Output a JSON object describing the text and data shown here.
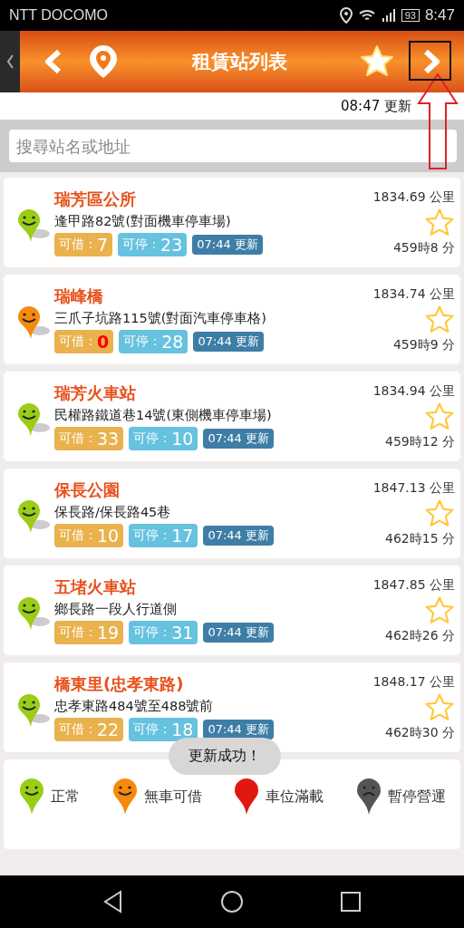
{
  "status_bar": {
    "carrier": "NTT DOCOMO",
    "battery": "93",
    "time": "8:47"
  },
  "header": {
    "title": "租賃站列表"
  },
  "update_time": "08:47 更新",
  "search": {
    "placeholder": "搜尋站名或地址"
  },
  "stations": [
    {
      "name": "瑞芳區公所",
      "address": "逢甲路82號(對面機車停車場)",
      "kind": "normal",
      "borrow_label": "可借：",
      "borrow": "7",
      "park_label": "可停：",
      "park": "23",
      "updated": "07:44 更新",
      "distance": "1834.69 公里",
      "duration": "459時8 分",
      "favorite": false
    },
    {
      "name": "瑞峰橋",
      "address": "三爪子坑路115號(對面汽車停車格)",
      "kind": "empty",
      "borrow_label": "可借：",
      "borrow": "0",
      "park_label": "可停：",
      "park": "28",
      "updated": "07:44 更新",
      "distance": "1834.74 公里",
      "duration": "459時9 分",
      "favorite": false
    },
    {
      "name": "瑞芳火車站",
      "address": "民權路鐵道巷14號(東側機車停車場)",
      "kind": "normal",
      "borrow_label": "可借：",
      "borrow": "33",
      "park_label": "可停：",
      "park": "10",
      "updated": "07:44 更新",
      "distance": "1834.94 公里",
      "duration": "459時12 分",
      "favorite": false
    },
    {
      "name": "保長公園",
      "address": "保長路/保長路45巷",
      "kind": "normal",
      "borrow_label": "可借：",
      "borrow": "10",
      "park_label": "可停：",
      "park": "17",
      "updated": "07:44 更新",
      "distance": "1847.13 公里",
      "duration": "462時15 分",
      "favorite": false
    },
    {
      "name": "五堵火車站",
      "address": "鄉長路一段人行道側",
      "kind": "normal",
      "borrow_label": "可借：",
      "borrow": "19",
      "park_label": "可停：",
      "park": "31",
      "updated": "07:44 更新",
      "distance": "1847.85 公里",
      "duration": "462時26 分",
      "favorite": false
    },
    {
      "name": "橋東里(忠孝東路)",
      "address": "忠孝東路484號至488號前",
      "kind": "normal",
      "borrow_label": "可借：",
      "borrow": "22",
      "park_label": "可停：",
      "park": "18",
      "updated": "07:44 更新",
      "distance": "1848.17 公里",
      "duration": "462時30 分",
      "favorite": false
    }
  ],
  "legend": [
    {
      "kind": "normal",
      "label": "正常"
    },
    {
      "kind": "empty",
      "label": "無車可借"
    },
    {
      "kind": "full",
      "label": "車位滿載"
    },
    {
      "kind": "closed",
      "label": "暫停營運"
    }
  ],
  "toast": "更新成功！"
}
